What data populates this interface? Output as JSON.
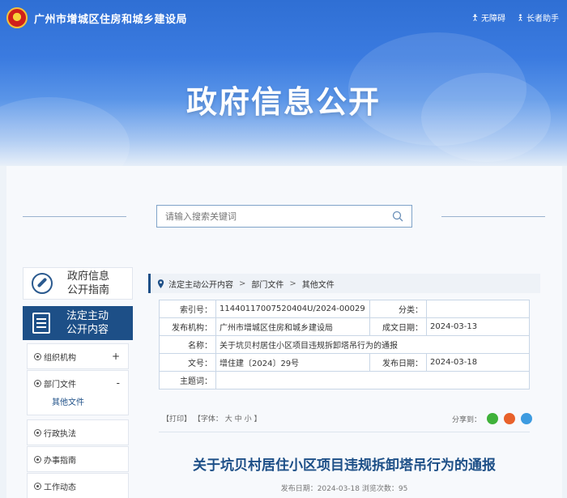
{
  "header": {
    "site_title": "广州市增城区住房和城乡建设局",
    "links": [
      {
        "label": "无障碍",
        "icon": "accessibility-icon"
      },
      {
        "label": "长者助手",
        "icon": "elder-icon"
      }
    ],
    "banner_title": "政府信息公开"
  },
  "search": {
    "placeholder": "请输入搜索关键词",
    "icon": "search-icon"
  },
  "sidebar": {
    "guide_line1": "政府信息",
    "guide_line2": "公开指南",
    "active_line1": "法定主动",
    "active_line2": "公开内容",
    "items": [
      {
        "label": "组织机构",
        "toggle": "+"
      },
      {
        "label": "部门文件",
        "toggle": "-",
        "sub": "其他文件"
      },
      {
        "label": "行政执法"
      },
      {
        "label": "办事指南"
      },
      {
        "label": "工作动态"
      }
    ]
  },
  "breadcrumb": [
    "法定主动公开内容",
    "部门文件",
    "其他文件"
  ],
  "breadcrumb_sep": ">",
  "info": {
    "index_label": "索引号：",
    "index_value": "11440117007520404U/2024-00029",
    "category_label": "分类：",
    "category_value": "",
    "publisher_label": "发布机构：",
    "publisher_value": "广州市增城区住房和城乡建设局",
    "created_label": "成文日期：",
    "created_value": "2024-03-13",
    "name_label": "名称：",
    "name_value": "关于坑贝村居住小区项目违规拆卸塔吊行为的通报",
    "docno_label": "文号：",
    "docno_value": "增住建〔2024〕29号",
    "published_label": "发布日期：",
    "published_value": "2024-03-18",
    "subject_label": "主题词："
  },
  "tools": {
    "print": "【打印】",
    "font": "【字体：",
    "large": "大",
    "medium": "中",
    "small": "小",
    "close": "】",
    "share_label": "分享到："
  },
  "article": {
    "title": "关于坑贝村居住小区项目违规拆卸塔吊行为的通报",
    "meta": "发布日期：2024-03-18  浏览次数：95"
  },
  "colors": {
    "primary": "#1d4f87",
    "wechat": "#3fb13a",
    "weibo": "#e8612a",
    "qq": "#3d9be0"
  }
}
